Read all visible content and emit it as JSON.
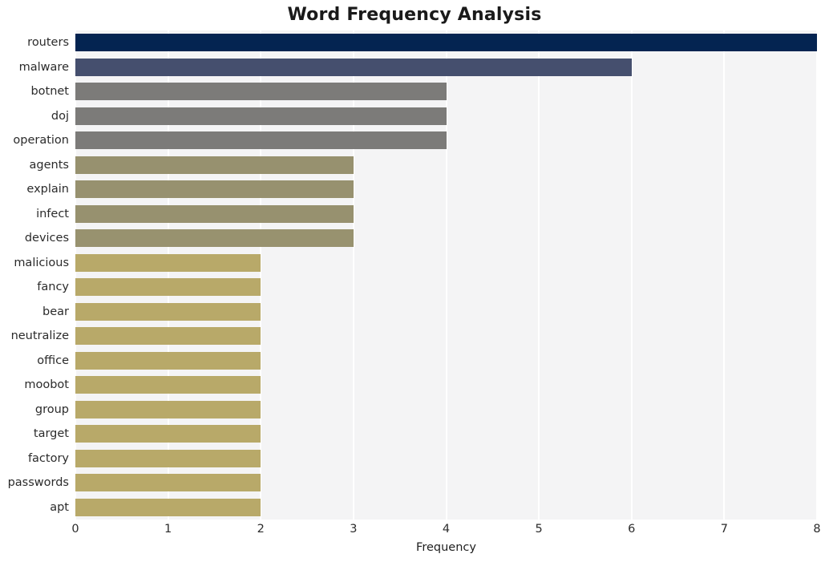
{
  "chart_data": {
    "type": "bar",
    "orientation": "horizontal",
    "title": "Word Frequency Analysis",
    "xlabel": "Frequency",
    "ylabel": "",
    "xlim": [
      0,
      8
    ],
    "xticks": [
      0,
      1,
      2,
      3,
      4,
      5,
      6,
      7,
      8
    ],
    "xtick_labels": [
      "0",
      "1",
      "2",
      "3",
      "4",
      "5",
      "6",
      "7",
      "8"
    ],
    "grid": true,
    "grid_axis": "x",
    "legend": false,
    "categories": [
      "routers",
      "malware",
      "botnet",
      "doj",
      "operation",
      "agents",
      "explain",
      "infect",
      "devices",
      "malicious",
      "fancy",
      "bear",
      "neutralize",
      "office",
      "moobot",
      "group",
      "target",
      "factory",
      "passwords",
      "apt"
    ],
    "values": [
      8,
      6,
      4,
      4,
      4,
      3,
      3,
      3,
      3,
      2,
      2,
      2,
      2,
      2,
      2,
      2,
      2,
      2,
      2,
      2
    ],
    "bar_colors": [
      "#042451",
      "#454F6E",
      "#7C7B79",
      "#7C7B79",
      "#7C7B79",
      "#97916F",
      "#97916F",
      "#97916F",
      "#98926F",
      "#B8A969",
      "#B8A969",
      "#B8A969",
      "#B8A969",
      "#B8A969",
      "#B8A969",
      "#B8A969",
      "#B8A969",
      "#B8A969",
      "#B8A969",
      "#B8A969"
    ],
    "style": {
      "plot_background": "#f4f4f5",
      "gridline_color": "#ffffff",
      "figure_background": "#ffffff",
      "text_color": "#2b2b2b"
    }
  }
}
